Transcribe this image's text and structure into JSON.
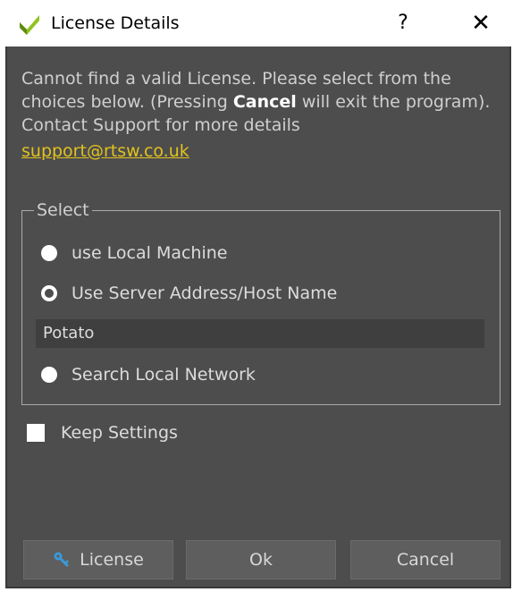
{
  "window": {
    "title": "License Details",
    "help_label": "?",
    "close_label": "✕"
  },
  "message": {
    "part1": "Cannot find a valid License. Please select from the choices below. (Pressing ",
    "bold": "Cancel",
    "part2": " will exit the program). Contact Support for more details",
    "link": "support@rtsw.co.uk"
  },
  "select": {
    "title": "Select",
    "options": [
      {
        "label": "use Local Machine",
        "checked": false
      },
      {
        "label": "Use Server Address/Host Name",
        "checked": true
      },
      {
        "label": "Search Local Network",
        "checked": false
      }
    ],
    "server_value": "Potato"
  },
  "keep_settings": {
    "label": "Keep Settings",
    "checked": false
  },
  "buttons": {
    "license": "License",
    "ok": "Ok",
    "cancel": "Cancel"
  },
  "colors": {
    "background": "#4d4d4d",
    "link": "#e1c21e",
    "icon_green": "#8fc31f",
    "key_blue": "#3a9ad9"
  }
}
